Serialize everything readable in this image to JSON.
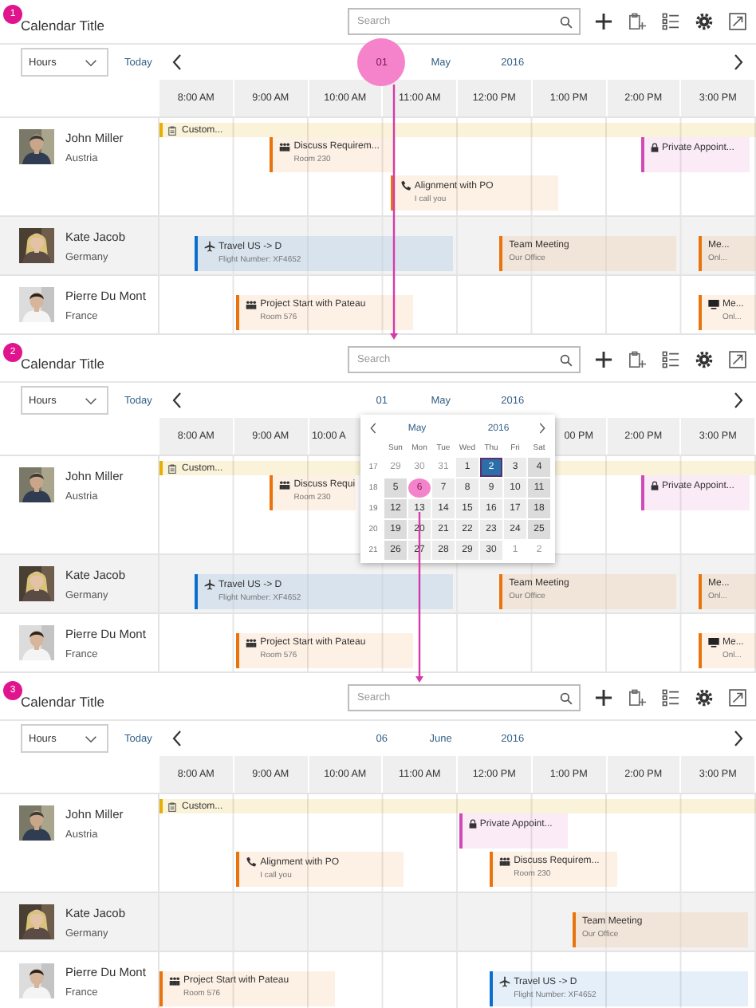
{
  "panels": [
    {
      "step": "1",
      "title": "Calendar Title",
      "search": {
        "placeholder": "Search"
      },
      "view": "Hours",
      "today": "Today",
      "date": {
        "day": "01",
        "month": "May",
        "year": "2016",
        "tapped": true
      },
      "hours": [
        "8:00 AM",
        "9:00 AM",
        "10:00 AM",
        "11:00 AM",
        "12:00 PM",
        "1:00 PM",
        "2:00 PM",
        "3:00 PM"
      ],
      "rows": [
        {
          "name": "John Miller",
          "country": "Austria",
          "selected": false,
          "appointments": [
            {
              "kind": "band",
              "title": "Custom...",
              "color": "#e5b000"
            },
            {
              "kind": "meeting",
              "title": "Discuss Requirem...",
              "subtitle": "Room 230",
              "color": "#e9730c"
            },
            {
              "kind": "private",
              "title": "Private Appoint...",
              "color": "#d04bb5"
            },
            {
              "kind": "call",
              "title": "Alignment with PO",
              "subtitle": "I call you",
              "color": "#e9730c"
            }
          ]
        },
        {
          "name": "Kate Jacob",
          "country": "Germany",
          "selected": true,
          "appointments": [
            {
              "kind": "travel",
              "title": "Travel US -> D",
              "subtitle": "Flight Number: XF4652",
              "color": "#0a6ed1"
            },
            {
              "kind": "plain",
              "title": "Team Meeting",
              "subtitle": "Our Office",
              "color": "#e9730c"
            },
            {
              "kind": "plain",
              "title": "Me...",
              "subtitle": "Onl...",
              "color": "#e9730c"
            }
          ]
        },
        {
          "name": "Pierre Du Mont",
          "country": "France",
          "selected": false,
          "appointments": [
            {
              "kind": "meeting",
              "title": "Project Start with Pateau",
              "subtitle": "Room 576",
              "color": "#e9730c"
            },
            {
              "kind": "screen",
              "title": "Me...",
              "subtitle": "Onl...",
              "color": "#e9730c"
            }
          ]
        }
      ]
    },
    {
      "step": "2",
      "title": "Calendar Title",
      "search": {
        "placeholder": "Search"
      },
      "view": "Hours",
      "today": "Today",
      "date": {
        "day": "01",
        "month": "May",
        "year": "2016",
        "tapped": false
      },
      "hours": [
        "8:00 AM",
        "9:00 AM",
        "10:00 A",
        "00 PM",
        "2:00 PM",
        "3:00 PM"
      ],
      "picker": {
        "month": "May",
        "year": "2016",
        "weekdays": [
          "Sun",
          "Mon",
          "Tue",
          "Wed",
          "Thu",
          "Fri",
          "Sat"
        ],
        "weeks": [
          {
            "week": "17",
            "days": [
              {
                "label": "29",
                "other_month": true,
                "selected": false,
                "tapped": false
              },
              {
                "label": "30",
                "other_month": true,
                "selected": false,
                "tapped": false
              },
              {
                "label": "31",
                "other_month": true,
                "selected": false,
                "tapped": false
              },
              {
                "label": "1",
                "other_month": false,
                "selected": false,
                "tapped": false
              },
              {
                "label": "2",
                "other_month": false,
                "selected": true,
                "tapped": false
              },
              {
                "label": "3",
                "other_month": false,
                "selected": false,
                "tapped": false
              },
              {
                "label": "4",
                "other_month": false,
                "selected": false,
                "tapped": false
              }
            ]
          },
          {
            "week": "18",
            "days": [
              {
                "label": "5",
                "other_month": false,
                "selected": false,
                "tapped": false
              },
              {
                "label": "6",
                "other_month": false,
                "selected": false,
                "tapped": true
              },
              {
                "label": "7",
                "other_month": false,
                "selected": false,
                "tapped": false
              },
              {
                "label": "8",
                "other_month": false,
                "selected": false,
                "tapped": false
              },
              {
                "label": "9",
                "other_month": false,
                "selected": false,
                "tapped": false
              },
              {
                "label": "10",
                "other_month": false,
                "selected": false,
                "tapped": false
              },
              {
                "label": "11",
                "other_month": false,
                "selected": false,
                "tapped": false
              }
            ]
          },
          {
            "week": "19",
            "days": [
              {
                "label": "12",
                "other_month": false,
                "selected": false,
                "tapped": false
              },
              {
                "label": "13",
                "other_month": false,
                "selected": false,
                "tapped": false
              },
              {
                "label": "14",
                "other_month": false,
                "selected": false,
                "tapped": false
              },
              {
                "label": "15",
                "other_month": false,
                "selected": false,
                "tapped": false
              },
              {
                "label": "16",
                "other_month": false,
                "selected": false,
                "tapped": false
              },
              {
                "label": "17",
                "other_month": false,
                "selected": false,
                "tapped": false
              },
              {
                "label": "18",
                "other_month": false,
                "selected": false,
                "tapped": false
              }
            ]
          },
          {
            "week": "20",
            "days": [
              {
                "label": "19",
                "other_month": false,
                "selected": false,
                "tapped": false
              },
              {
                "label": "20",
                "other_month": false,
                "selected": false,
                "tapped": false
              },
              {
                "label": "21",
                "other_month": false,
                "selected": false,
                "tapped": false
              },
              {
                "label": "22",
                "other_month": false,
                "selected": false,
                "tapped": false
              },
              {
                "label": "23",
                "other_month": false,
                "selected": false,
                "tapped": false
              },
              {
                "label": "24",
                "other_month": false,
                "selected": false,
                "tapped": false
              },
              {
                "label": "25",
                "other_month": false,
                "selected": false,
                "tapped": false
              }
            ]
          },
          {
            "week": "21",
            "days": [
              {
                "label": "26",
                "other_month": false,
                "selected": false,
                "tapped": false
              },
              {
                "label": "27",
                "other_month": false,
                "selected": false,
                "tapped": false
              },
              {
                "label": "28",
                "other_month": false,
                "selected": false,
                "tapped": false
              },
              {
                "label": "29",
                "other_month": false,
                "selected": false,
                "tapped": false
              },
              {
                "label": "30",
                "other_month": false,
                "selected": false,
                "tapped": false
              },
              {
                "label": "1",
                "other_month": true,
                "selected": false,
                "tapped": false
              },
              {
                "label": "2",
                "other_month": true,
                "selected": false,
                "tapped": false
              }
            ]
          }
        ]
      },
      "rows": [
        {
          "name": "John Miller",
          "country": "Austria",
          "selected": false,
          "appointments": [
            {
              "kind": "band",
              "title": "Custom...",
              "color": "#e5b000"
            },
            {
              "kind": "meeting",
              "title": "Discuss Requi",
              "subtitle": "Room 230",
              "color": "#e9730c"
            },
            {
              "kind": "private",
              "title": "Private Appoint...",
              "color": "#d04bb5"
            }
          ]
        },
        {
          "name": "Kate Jacob",
          "country": "Germany",
          "selected": true,
          "appointments": [
            {
              "kind": "travel",
              "title": "Travel US -> D",
              "subtitle": "Flight Number: XF4652",
              "color": "#0a6ed1"
            },
            {
              "kind": "plain",
              "title": "Team Meeting",
              "subtitle": "Our Office",
              "color": "#e9730c"
            },
            {
              "kind": "plain",
              "title": "Me...",
              "subtitle": "Onl...",
              "color": "#e9730c"
            }
          ]
        },
        {
          "name": "Pierre Du Mont",
          "country": "France",
          "selected": false,
          "appointments": [
            {
              "kind": "meeting",
              "title": "Project Start with Pateau",
              "subtitle": "Room 576",
              "color": "#e9730c"
            },
            {
              "kind": "screen",
              "title": "Me...",
              "subtitle": "Onl...",
              "color": "#e9730c"
            }
          ]
        }
      ]
    },
    {
      "step": "3",
      "title": "Calendar Title",
      "search": {
        "placeholder": "Search"
      },
      "view": "Hours",
      "today": "Today",
      "date": {
        "day": "06",
        "month": "June",
        "year": "2016",
        "tapped": false
      },
      "hours": [
        "8:00 AM",
        "9:00 AM",
        "10:00 AM",
        "11:00 AM",
        "12:00 PM",
        "1:00 PM",
        "2:00 PM",
        "3:00 PM"
      ],
      "rows": [
        {
          "name": "John Miller",
          "country": "Austria",
          "selected": false,
          "appointments": [
            {
              "kind": "band",
              "title": "Custom...",
              "color": "#e5b000"
            },
            {
              "kind": "private",
              "title": "Private Appoint...",
              "color": "#d04bb5"
            },
            {
              "kind": "call",
              "title": "Alignment with PO",
              "subtitle": "I call you",
              "color": "#e9730c"
            },
            {
              "kind": "meeting",
              "title": "Discuss Requirem...",
              "subtitle": "Room 230",
              "color": "#e9730c"
            }
          ]
        },
        {
          "name": "Kate Jacob",
          "country": "Germany",
          "selected": true,
          "appointments": [
            {
              "kind": "plain",
              "title": "Team Meeting",
              "subtitle": "Our Office",
              "color": "#e9730c"
            }
          ]
        },
        {
          "name": "Pierre Du Mont",
          "country": "France",
          "selected": false,
          "appointments": [
            {
              "kind": "meeting",
              "title": "Project Start with Pateau",
              "subtitle": "Room 576",
              "color": "#e9730c"
            },
            {
              "kind": "travel",
              "title": "Travel US -> D",
              "subtitle": "Flight Number: XF4652",
              "color": "#0a6ed1"
            }
          ]
        }
      ]
    }
  ]
}
